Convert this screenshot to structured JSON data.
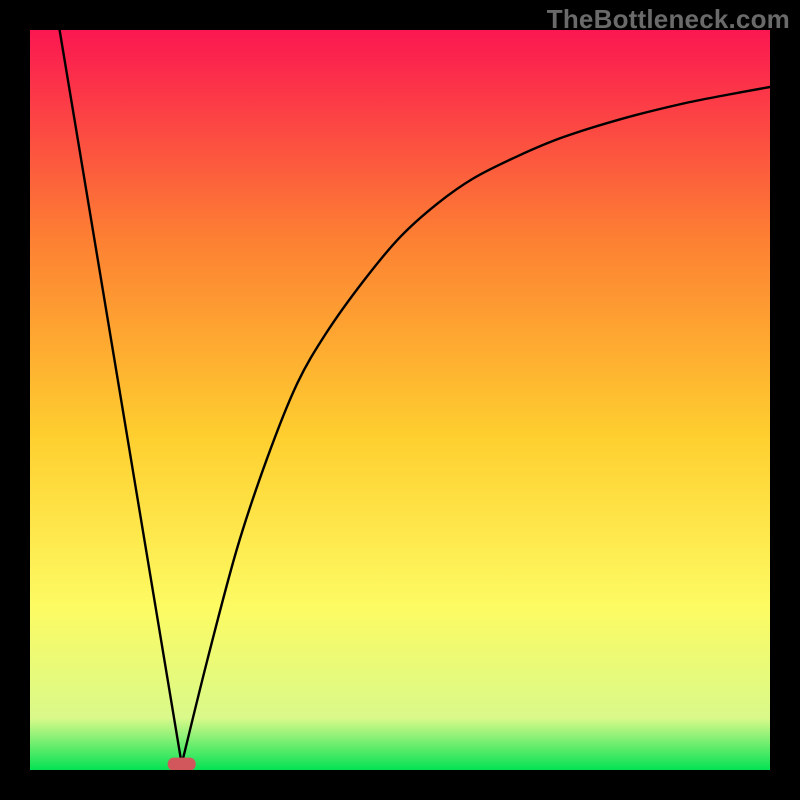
{
  "watermark": "TheBottleneck.com",
  "chart_data": {
    "type": "line",
    "title": "",
    "xlabel": "",
    "ylabel": "",
    "xlim": [
      0,
      100
    ],
    "ylim": [
      0,
      100
    ],
    "background_gradient": {
      "top": "#fb1751",
      "upper_mid": "#fd7f33",
      "mid": "#fecf2f",
      "lower_mid": "#fdfb63",
      "near_bottom": "#d9f98a",
      "bottom": "#04e254"
    },
    "marker": {
      "x": 20.5,
      "y": 0.8,
      "color": "#d1575d",
      "shape": "rounded-pill"
    },
    "series": [
      {
        "name": "left-segment",
        "x": [
          4.0,
          20.5
        ],
        "values": [
          100.0,
          0.8
        ]
      },
      {
        "name": "right-curve",
        "x": [
          20.5,
          24,
          28,
          32,
          36,
          40,
          45,
          50,
          55,
          60,
          66,
          72,
          80,
          88,
          94,
          100
        ],
        "values": [
          0.8,
          15,
          30,
          42,
          52,
          59,
          66,
          72,
          76.5,
          80,
          83,
          85.5,
          88,
          90,
          91.2,
          92.3
        ]
      }
    ]
  }
}
